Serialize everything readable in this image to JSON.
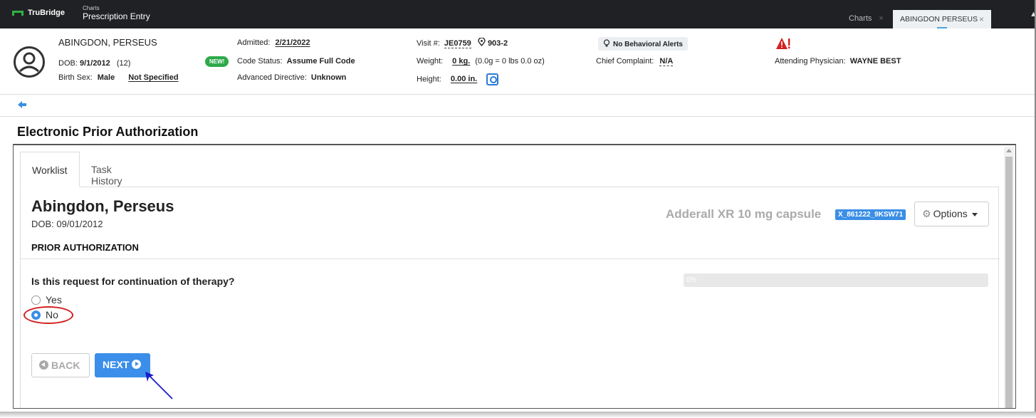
{
  "topbar": {
    "logo_text": "TruBridge",
    "crumb_small": "Charts",
    "crumb_main": "Prescription Entry",
    "tabs": [
      {
        "label": "Charts"
      },
      {
        "label": "ABINGDON PERSEUS"
      }
    ],
    "close_glyph": "×",
    "accent": "#2fb344"
  },
  "patient": {
    "last_name": "ABINGDON,",
    "first_name": " PERSEUS",
    "dob_label": "DOB:",
    "dob": "9/1/2012",
    "age": "(12)",
    "birth_sex_label": "Birth Sex:",
    "birth_sex": "Male",
    "gender_identity": "Not Specified",
    "new_badge": "NEW!",
    "admitted_label": "Admitted:",
    "admitted": "2/21/2022",
    "code_status_label": "Code Status:",
    "code_status": "Assume Full Code",
    "adv_directive_label": "Advanced Directive:",
    "adv_directive": "Unknown",
    "visit_label": "Visit #:",
    "visit": "JE0759",
    "room": "903-2",
    "weight_label": "Weight:",
    "weight": "0 kg.",
    "weight_detail": "(0.0g = 0 lbs 0.0 oz)",
    "height_label": "Height:",
    "height": "0.00 in.",
    "behavioral": "No Behavioral Alerts",
    "complaint_label": "Chief Complaint:",
    "complaint": "N/A",
    "physician_label": "Attending Physician:",
    "physician": "WAYNE BEST"
  },
  "page": {
    "title": "Electronic Prior Authorization"
  },
  "tabs": [
    {
      "label": "Worklist",
      "active": true
    },
    {
      "label": "Task History",
      "active": false
    }
  ],
  "form": {
    "patient_name": "Abingdon, Perseus",
    "dob_line": "DOB: 09/01/2012",
    "drug": "Adderall XR 10 mg capsule",
    "drug_code": "X_861222_9KSW71",
    "options_label": "Options",
    "section": "PRIOR AUTHORIZATION",
    "question": "Is this request for continuation of therapy?",
    "progress_label": "0%",
    "progress_value": 0,
    "choices": [
      {
        "label": "Yes",
        "checked": false
      },
      {
        "label": "No",
        "checked": true
      }
    ],
    "back_label": "BACK",
    "next_label": "NEXT"
  },
  "colors": {
    "primary": "#3b8eea",
    "highlight_ring": "#d32020",
    "pointer_arrow": "#1a1acc",
    "new_badge": "#2eaa4a"
  }
}
